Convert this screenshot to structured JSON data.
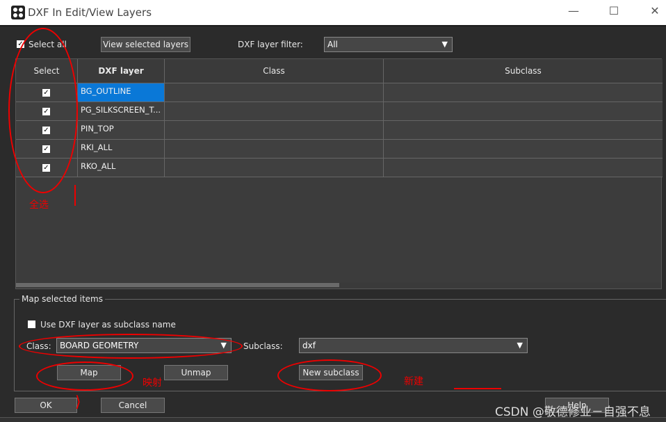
{
  "window": {
    "title": "DXF In Edit/View Layers",
    "controls": {
      "minimize": "—",
      "maximize": "☐",
      "close": "✕"
    }
  },
  "toolbar": {
    "select_all_label": "Select all",
    "select_all_checked": true,
    "view_selected_label": "View selected layers",
    "filter_label": "DXF layer filter:",
    "filter_value": "All"
  },
  "table": {
    "columns": [
      "Select",
      "DXF layer",
      "Class",
      "Subclass"
    ],
    "rows": [
      {
        "checked": true,
        "layer": "BG_OUTLINE",
        "class": "",
        "subclass": "",
        "selected": true
      },
      {
        "checked": true,
        "layer": "PG_SILKSCREEN_T...",
        "class": "",
        "subclass": ""
      },
      {
        "checked": true,
        "layer": "PIN_TOP",
        "class": "",
        "subclass": ""
      },
      {
        "checked": true,
        "layer": "RKI_ALL",
        "class": "",
        "subclass": ""
      },
      {
        "checked": true,
        "layer": "RKO_ALL",
        "class": "",
        "subclass": ""
      }
    ]
  },
  "map_group": {
    "title": "Map selected items",
    "use_layer_label": "Use DXF layer as subclass name",
    "use_layer_checked": false,
    "class_label": "Class:",
    "class_value": "BOARD GEOMETRY",
    "subclass_label": "Subclass:",
    "subclass_value": "dxf",
    "map_label": "Map",
    "unmap_label": "Unmap",
    "new_subclass_label": "New subclass"
  },
  "footer": {
    "ok_label": "OK",
    "cancel_label": "Cancel",
    "help_label": "Help"
  },
  "annotations": {
    "select_all_note": "全选",
    "map_note": "映射",
    "new_note": "新建",
    "color": "#e00000"
  },
  "watermark": "CSDN @敬德修业－自强不息"
}
